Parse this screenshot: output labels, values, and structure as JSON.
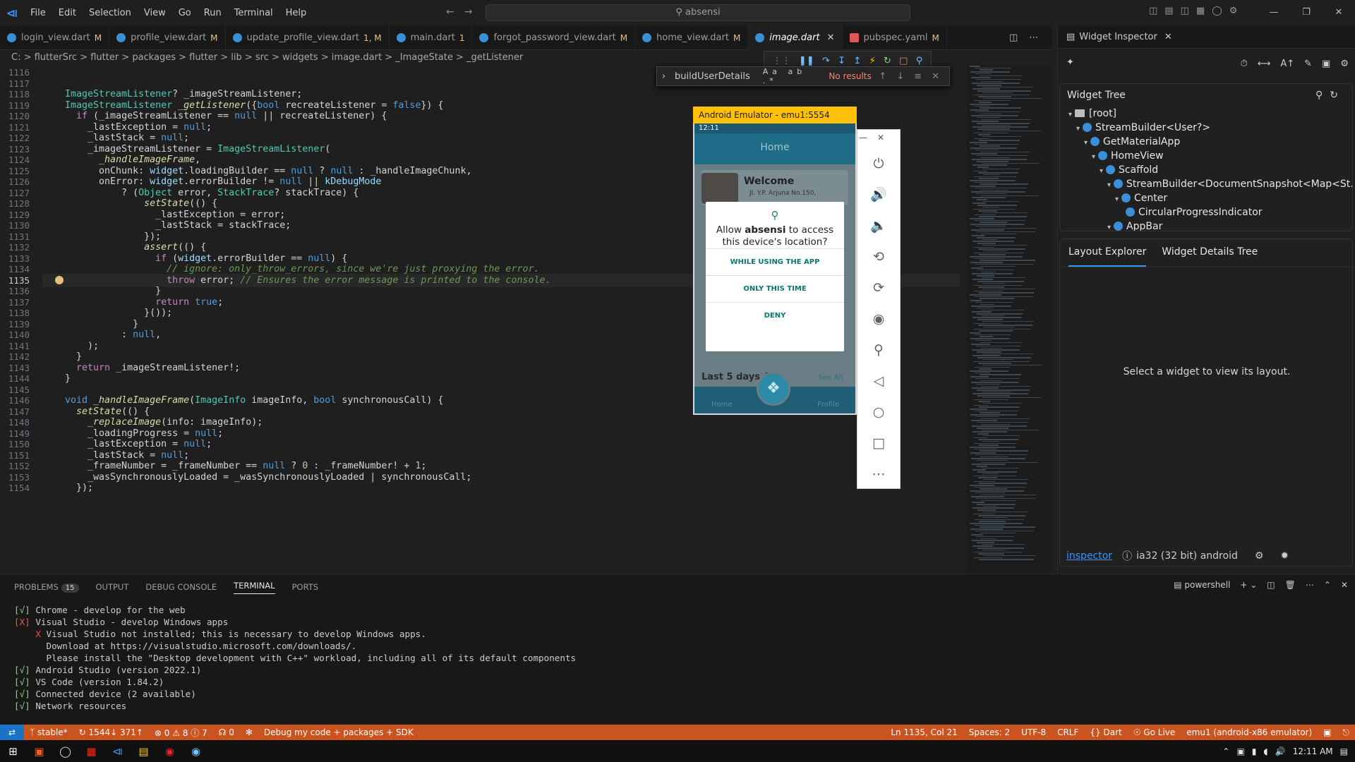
{
  "app": {
    "logo_icon": "vscode-logo-icon"
  },
  "menu": [
    "File",
    "Edit",
    "Selection",
    "View",
    "Go",
    "Run",
    "Terminal",
    "Help"
  ],
  "search": {
    "text": "absensi",
    "icon": "search-icon"
  },
  "window_controls": [
    "—",
    "❐",
    "✕"
  ],
  "tabs": [
    {
      "label": "login_view.dart",
      "mod": "M"
    },
    {
      "label": "profile_view.dart",
      "mod": "M"
    },
    {
      "label": "update_profile_view.dart",
      "mod": "1, M"
    },
    {
      "label": "main.dart",
      "mod": "1"
    },
    {
      "label": "forgot_password_view.dart",
      "mod": "M"
    },
    {
      "label": "home_view.dart",
      "mod": "M"
    },
    {
      "label": "image.dart",
      "mod": "",
      "active": true
    },
    {
      "label": "pubspec.yaml",
      "mod": "M",
      "yaml": true
    }
  ],
  "breadcrumb": "C: > flutterSrc > flutter > packages > flutter > lib > src > widgets > image.dart > _ImageState > _getListener",
  "find": {
    "query": "buildUserDetails",
    "result": "No results",
    "options": "Aa ab .*"
  },
  "code": {
    "current_line": 1135,
    "lines": [
      {
        "n": "1116",
        "t": ""
      },
      {
        "n": "1117",
        "t": ""
      },
      {
        "n": "1118",
        "t": "ImageStreamListener? _imageStreamListener;"
      },
      {
        "n": "1119",
        "t": "ImageStreamListener _getListener({bool recreateListener = false}) {"
      },
      {
        "n": "1120",
        "t": "  if (_imageStreamListener == null || recreateListener) {"
      },
      {
        "n": "1121",
        "t": "    _lastException = null;"
      },
      {
        "n": "1122",
        "t": "    _lastStack = null;"
      },
      {
        "n": "1123",
        "t": "    _imageStreamListener = ImageStreamListener("
      },
      {
        "n": "1124",
        "t": "      _handleImageFrame,"
      },
      {
        "n": "1125",
        "t": "      onChunk: widget.loadingBuilder == null ? null : _handleImageChunk,"
      },
      {
        "n": "1126",
        "t": "      onError: widget.errorBuilder != null || kDebugMode"
      },
      {
        "n": "1127",
        "t": "          ? (Object error, StackTrace? stackTrace) {"
      },
      {
        "n": "1128",
        "t": "              setState(() {"
      },
      {
        "n": "1129",
        "t": "                _lastException = error;"
      },
      {
        "n": "1130",
        "t": "                _lastStack = stackTrace;"
      },
      {
        "n": "1131",
        "t": "              });"
      },
      {
        "n": "1132",
        "t": "              assert(() {"
      },
      {
        "n": "1133",
        "t": "                if (widget.errorBuilder == null) {"
      },
      {
        "n": "1134",
        "t": "                  // ignore: only_throw_errors, since we're just proxying the error."
      },
      {
        "n": "1135",
        "t": "                  throw error; // Ensures the error message is printed to the console."
      },
      {
        "n": "1136",
        "t": "                }"
      },
      {
        "n": "1137",
        "t": "                return true;"
      },
      {
        "n": "1138",
        "t": "              }());"
      },
      {
        "n": "1139",
        "t": "            }"
      },
      {
        "n": "1140",
        "t": "          : null,"
      },
      {
        "n": "1141",
        "t": "    );"
      },
      {
        "n": "1142",
        "t": "  }"
      },
      {
        "n": "1143",
        "t": "  return _imageStreamListener!;"
      },
      {
        "n": "1144",
        "t": "}"
      },
      {
        "n": "1145",
        "t": ""
      },
      {
        "n": "1146",
        "t": "void _handleImageFrame(ImageInfo imageInfo, bool synchronousCall) {"
      },
      {
        "n": "1147",
        "t": "  setState(() {"
      },
      {
        "n": "1148",
        "t": "    _replaceImage(info: imageInfo);"
      },
      {
        "n": "1149",
        "t": "    _loadingProgress = null;"
      },
      {
        "n": "1150",
        "t": "    _lastException = null;"
      },
      {
        "n": "1151",
        "t": "    _lastStack = null;"
      },
      {
        "n": "1152",
        "t": "    _frameNumber = _frameNumber == null ? 0 : _frameNumber! + 1;"
      },
      {
        "n": "1153",
        "t": "    _wasSynchronouslyLoaded = _wasSynchronouslyLoaded | synchronousCall;"
      },
      {
        "n": "1154",
        "t": "  });"
      }
    ]
  },
  "emulator": {
    "title": "Android Emulator - emu1:5554",
    "time": "12:11",
    "appbar_title": "Home",
    "welcome": "Welcome",
    "address": "Jl. Y.P. Arjuna No.150,",
    "dialog_pre": "Allow ",
    "dialog_app": "absensi",
    "dialog_post": " to access this device's location?",
    "options": [
      "WHILE USING THE APP",
      "ONLY THIS TIME",
      "DENY"
    ],
    "last_days": "Last 5 days A",
    "see_all": "See All",
    "nav_home": "Home",
    "nav_profile": "Profile",
    "controls": [
      "power-icon",
      "volume-up-icon",
      "volume-down-icon",
      "rotate-left-icon",
      "rotate-right-icon",
      "camera-icon",
      "zoom-icon",
      "back-icon",
      "home-icon",
      "overview-icon",
      "more-icon"
    ]
  },
  "inspector": {
    "tab": "Widget Inspector",
    "tree_title": "Widget Tree",
    "nodes": [
      {
        "label": "[root]",
        "depth": 0,
        "kind": "folder"
      },
      {
        "label": "StreamBuilder<User?>",
        "depth": 1,
        "kind": "widget"
      },
      {
        "label": "GetMaterialApp",
        "depth": 2,
        "kind": "widget"
      },
      {
        "label": "HomeView",
        "depth": 3,
        "kind": "widget"
      },
      {
        "label": "Scaffold",
        "depth": 4,
        "kind": "widget"
      },
      {
        "label": "StreamBuilder<DocumentSnapshot<Map<St...",
        "depth": 5,
        "kind": "widget"
      },
      {
        "label": "Center",
        "depth": 6,
        "kind": "widget"
      },
      {
        "label": "CircularProgressIndicator",
        "depth": 7,
        "kind": "widget"
      },
      {
        "label": "AppBar",
        "depth": 5,
        "kind": "widget"
      }
    ],
    "layout_tab": "Layout Explorer",
    "details_tab": "Widget Details Tree",
    "empty_msg": "Select a widget to view its layout.",
    "footer_link": "inspector",
    "footer_device": "ia32 (32 bit) android"
  },
  "panel": {
    "tabs": [
      {
        "label": "PROBLEMS",
        "badge": "15"
      },
      {
        "label": "OUTPUT"
      },
      {
        "label": "DEBUG CONSOLE"
      },
      {
        "label": "TERMINAL",
        "active": true
      },
      {
        "label": "PORTS"
      }
    ],
    "shell": "powershell",
    "terminal": "[√] Chrome - develop for the web\n[X] Visual Studio - develop Windows apps\n    X Visual Studio not installed; this is necessary to develop Windows apps.\n      Download at https://visualstudio.microsoft.com/downloads/.\n      Please install the \"Desktop development with C++\" workload, including all of its default components\n[√] Android Studio (version 2022.1)\n[√] VS Code (version 1.84.2)\n[√] Connected device (2 available)\n[√] Network resources"
  },
  "status": {
    "branch": "stable*",
    "sync": "1544↓ 371↑",
    "problems": "⊗ 0 ⚠ 8 ⓘ 7",
    "ports": "0",
    "debug": "Debug my code + packages + SDK",
    "position": "Ln 1135, Col 21",
    "spaces": "Spaces: 2",
    "encoding": "UTF-8",
    "eol": "CRLF",
    "lang": "{} Dart",
    "golive": "Go Live",
    "device": "emu1 (android-x86 emulator)"
  },
  "taskbar": {
    "time": "12:11 AM"
  },
  "colors": {
    "status_bg": "#c9541f",
    "accent": "#3794ff",
    "emu_title": "#ffc107"
  }
}
